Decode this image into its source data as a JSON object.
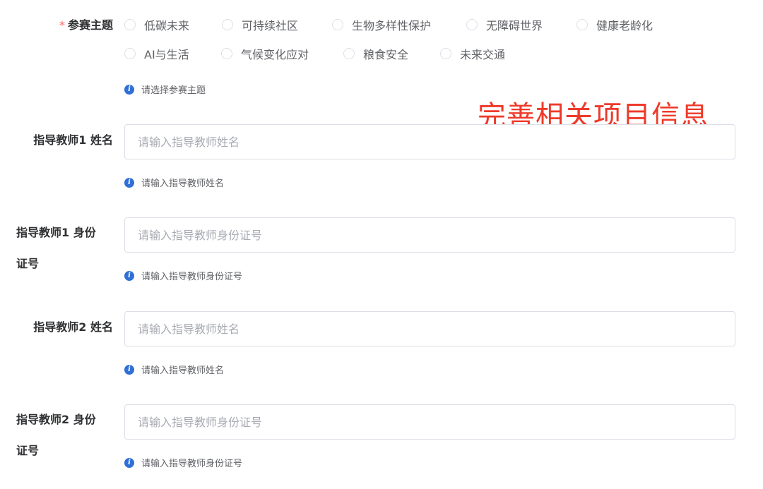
{
  "theme": {
    "required_mark": "*",
    "label": "参赛主题",
    "options": [
      "低碳未来",
      "可持续社区",
      "生物多样性保护",
      "无障碍世界",
      "健康老龄化",
      "AI与生活",
      "气候变化应对",
      "粮食安全",
      "未来交通"
    ],
    "hint": "请选择参赛主题"
  },
  "annotation": "完善相关项目信息",
  "teacher1_name": {
    "label": "指导教师1 姓名",
    "placeholder": "请输入指导教师姓名",
    "hint": "请输入指导教师姓名"
  },
  "teacher1_id": {
    "label_line1": "指导教师1 身份",
    "label_line2": "证号",
    "placeholder": "请输入指导教师身份证号",
    "hint": "请输入指导教师身份证号"
  },
  "teacher2_name": {
    "label": "指导教师2 姓名",
    "placeholder": "请输入指导教师姓名",
    "hint": "请输入指导教师姓名"
  },
  "teacher2_id": {
    "label_line1": "指导教师2 身份",
    "label_line2": "证号",
    "placeholder": "请输入指导教师身份证号",
    "hint": "请输入指导教师身份证号"
  },
  "colors": {
    "accent_info": "#2f6fd6",
    "required": "#f56c6c",
    "annotation": "#ee3a2a",
    "border": "#dcdfe6"
  }
}
